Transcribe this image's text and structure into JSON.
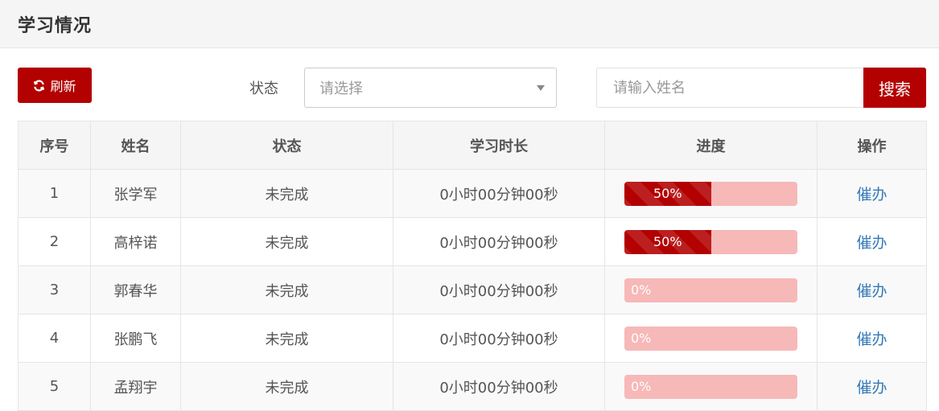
{
  "header": {
    "title": "学习情况"
  },
  "toolbar": {
    "refresh_label": "刷新",
    "refresh_icon": "refresh-icon",
    "status_label": "状态",
    "status_select_placeholder": "请选择",
    "search_placeholder": "请输入姓名",
    "search_label": "搜索"
  },
  "colors": {
    "accent": "#b30000",
    "progress_track": "#f7b8b8",
    "link": "#337ab7"
  },
  "table": {
    "columns": [
      "序号",
      "姓名",
      "状态",
      "学习时长",
      "进度",
      "操作"
    ],
    "rows": [
      {
        "index": "1",
        "name": "张学军",
        "status": "未完成",
        "duration": "0小时00分钟00秒",
        "progress": 50,
        "progress_label": "50%",
        "action": "催办"
      },
      {
        "index": "2",
        "name": "高梓诺",
        "status": "未完成",
        "duration": "0小时00分钟00秒",
        "progress": 50,
        "progress_label": "50%",
        "action": "催办"
      },
      {
        "index": "3",
        "name": "郭春华",
        "status": "未完成",
        "duration": "0小时00分钟00秒",
        "progress": 0,
        "progress_label": "0%",
        "action": "催办"
      },
      {
        "index": "4",
        "name": "张鹏飞",
        "status": "未完成",
        "duration": "0小时00分钟00秒",
        "progress": 0,
        "progress_label": "0%",
        "action": "催办"
      },
      {
        "index": "5",
        "name": "孟翔宇",
        "status": "未完成",
        "duration": "0小时00分钟00秒",
        "progress": 0,
        "progress_label": "0%",
        "action": "催办"
      }
    ]
  }
}
